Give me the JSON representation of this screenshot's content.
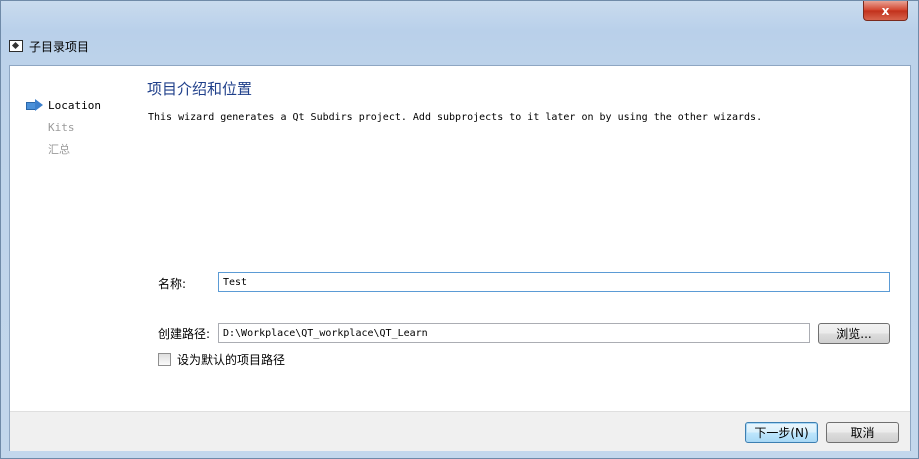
{
  "window": {
    "title": "子目录项目",
    "close_label": "x"
  },
  "steps": [
    {
      "label": "Location",
      "active": true
    },
    {
      "label": "Kits",
      "active": false
    },
    {
      "label": "汇总",
      "active": false
    }
  ],
  "page": {
    "title": "项目介绍和位置",
    "description": "This wizard generates a Qt Subdirs project. Add subprojects to it later on by using the other wizards."
  },
  "form": {
    "name_label": "名称:",
    "name_value": "Test",
    "path_label": "创建路径:",
    "path_value": "D:\\Workplace\\QT_workplace\\QT_Learn",
    "browse_label": "浏览...",
    "default_path_label": "设为默认的项目路径",
    "default_path_checked": false
  },
  "footer": {
    "next_label": "下一步(N)",
    "cancel_label": "取消"
  }
}
